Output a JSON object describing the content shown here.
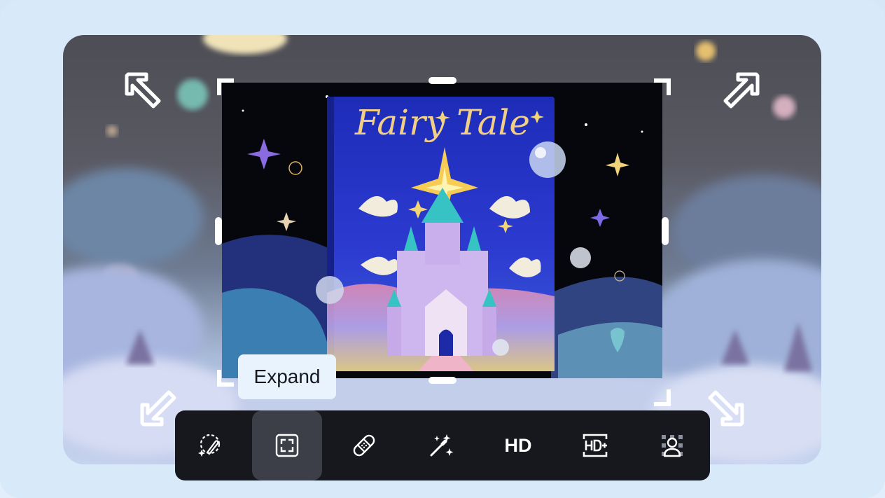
{
  "book": {
    "title": "Fairy Tale"
  },
  "tooltip": {
    "label": "Expand"
  },
  "toolbar": {
    "items": [
      {
        "id": "magic-brush",
        "icon": "magic-brush-icon"
      },
      {
        "id": "expand",
        "icon": "expand-frame-icon",
        "active": true
      },
      {
        "id": "remove-object",
        "icon": "bandage-icon"
      },
      {
        "id": "magic-wand",
        "icon": "magic-wand-icon"
      },
      {
        "id": "hd",
        "label": "HD"
      },
      {
        "id": "hd-plus",
        "icon": "hd-plus-icon"
      },
      {
        "id": "remove-background",
        "icon": "person-cutout-icon"
      }
    ]
  },
  "colors": {
    "toolbar_bg": "#16181e",
    "active_tool_bg": "#3c3f47",
    "tooltip_bg": "#e9f3fd"
  }
}
